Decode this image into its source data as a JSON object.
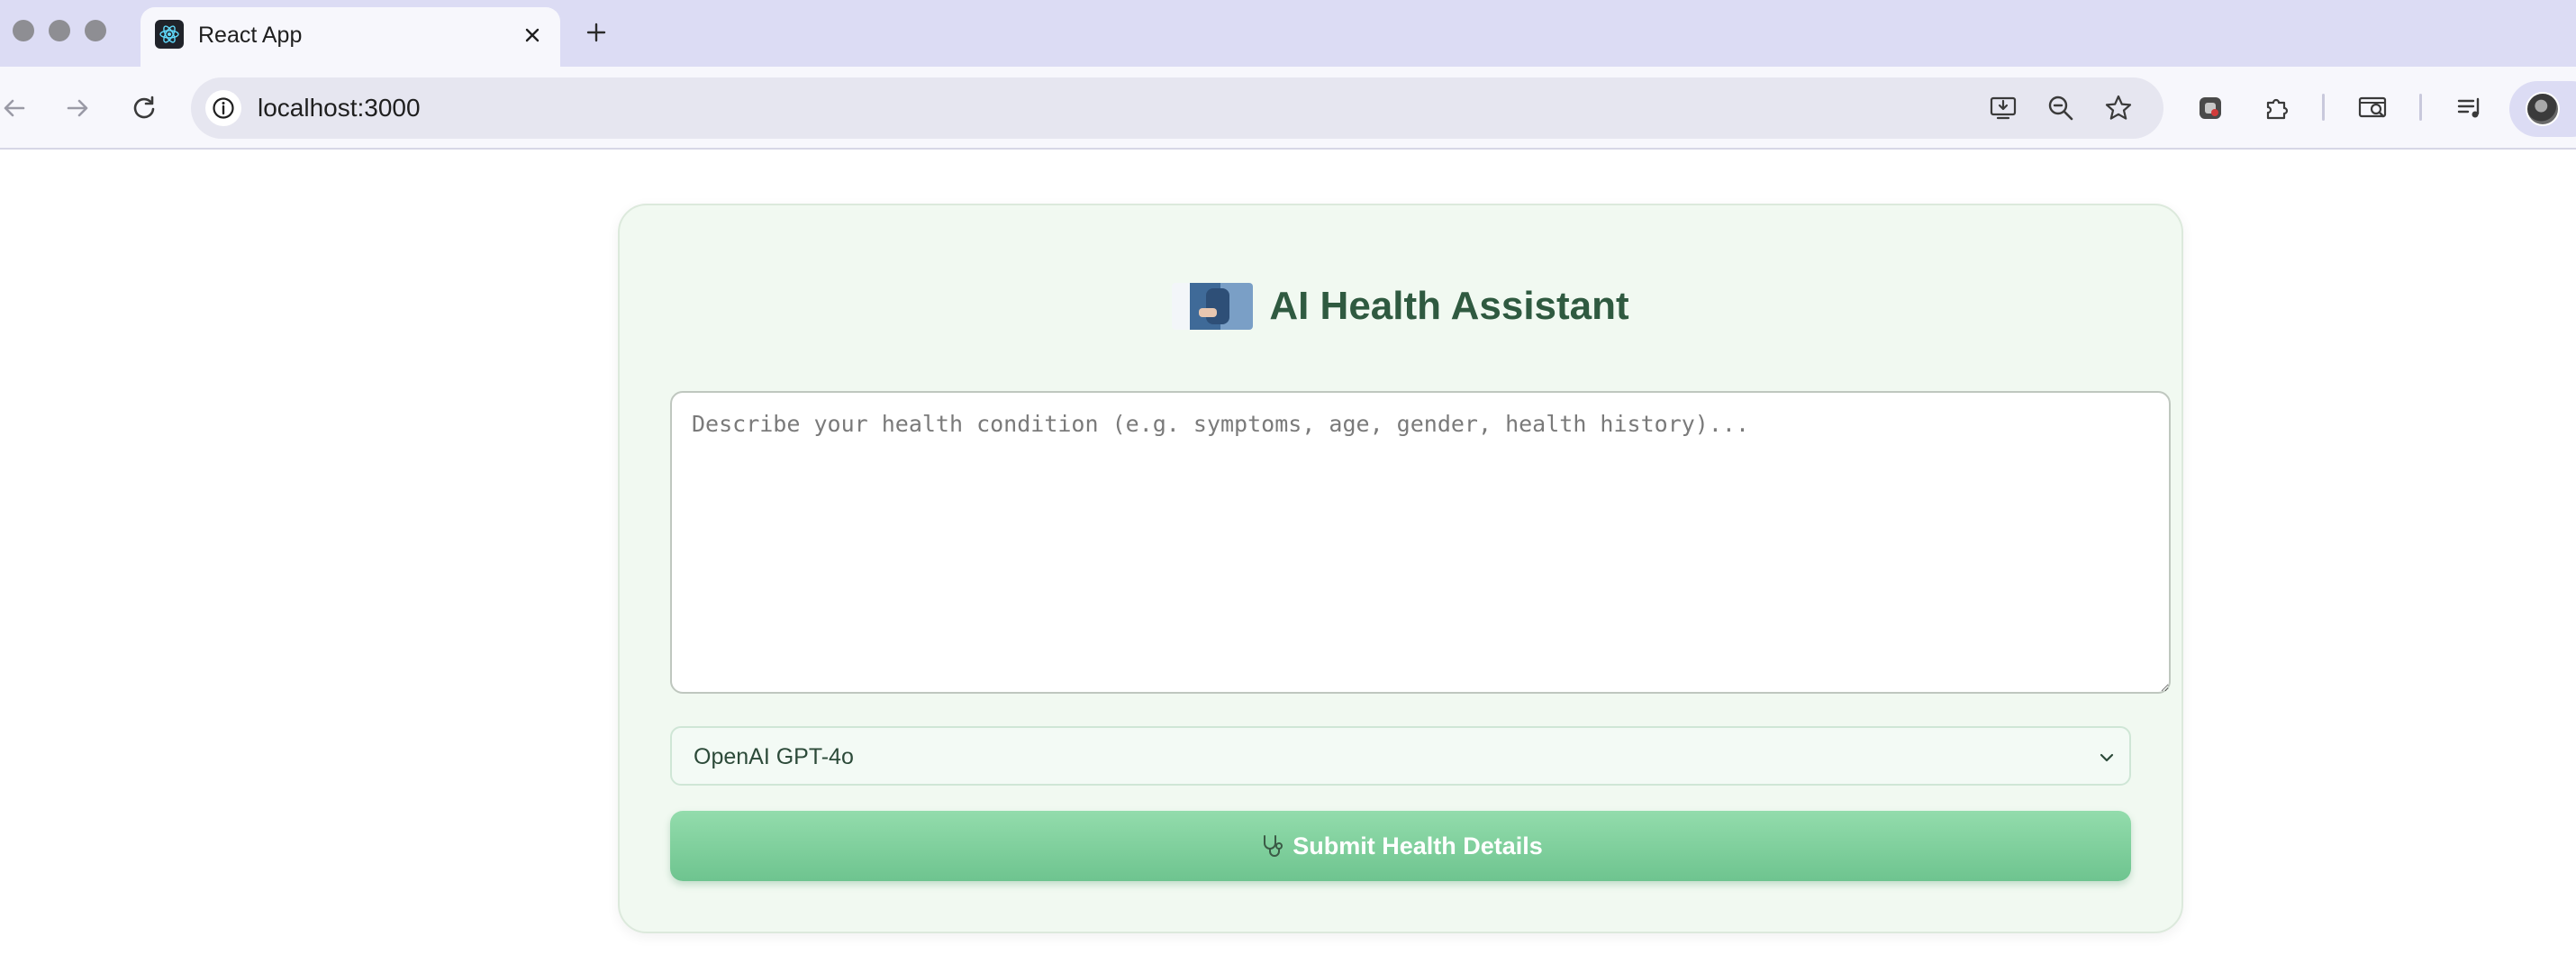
{
  "browser": {
    "tab": {
      "title": "React App",
      "favicon_icon": "react-logo-icon"
    },
    "address_bar": {
      "url": "localhost:3000"
    },
    "toolbar_icons": [
      "back-icon",
      "forward-icon",
      "reload-icon",
      "site-info-icon",
      "install-icon",
      "zoom-out-icon",
      "bookmark-star-icon",
      "extension-icon",
      "puzzle-icon",
      "cast-icon",
      "media-controls-icon",
      "profile-avatar"
    ]
  },
  "app": {
    "title": "AI Health Assistant",
    "health_input": {
      "value": "",
      "placeholder": "Describe your health condition (e.g. symptoms, age, gender, health history)..."
    },
    "model_select": {
      "selected": "OpenAI GPT-4o"
    },
    "submit_button": {
      "label": "Submit Health Details",
      "icon": "stethoscope-icon"
    }
  },
  "colors": {
    "card_background": "#f1f9f1",
    "title_color": "#2f5a40",
    "button_green": "#7fd19e",
    "chrome_tabbar": "#dcdcf4"
  }
}
